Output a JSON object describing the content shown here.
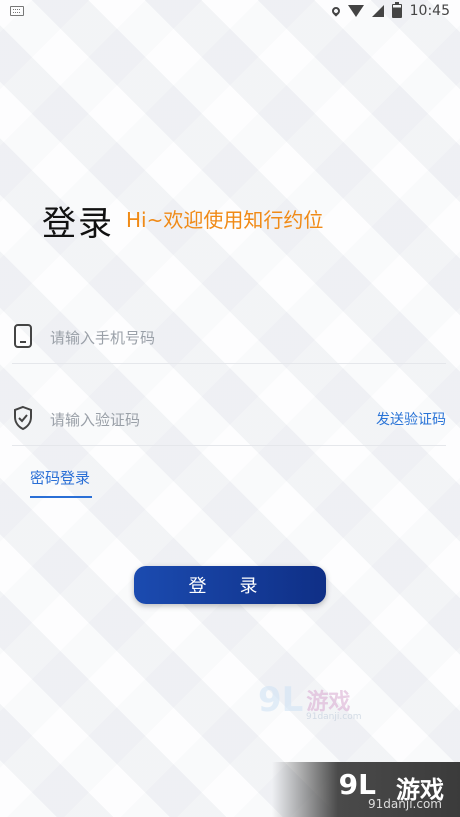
{
  "status_bar": {
    "time": "10:45"
  },
  "header": {
    "title": "登录",
    "subtitle": "Hi~欢迎使用知行约位"
  },
  "form": {
    "phone": {
      "placeholder": "请输入手机号码"
    },
    "code": {
      "placeholder": "请输入验证码",
      "send_label": "发送验证码"
    },
    "password_login_label": "密码登录",
    "login_button_label": "登 录"
  },
  "watermark": {
    "brand": "9L",
    "name": "游戏",
    "url": "91danji.com"
  },
  "colors": {
    "accent_orange": "#f08a16",
    "link_blue": "#2a6fd6",
    "button_start": "#1b4bb0",
    "button_end": "#0f2f86"
  },
  "icons": {
    "phone": "phone-icon",
    "shield": "shield-check-icon"
  }
}
